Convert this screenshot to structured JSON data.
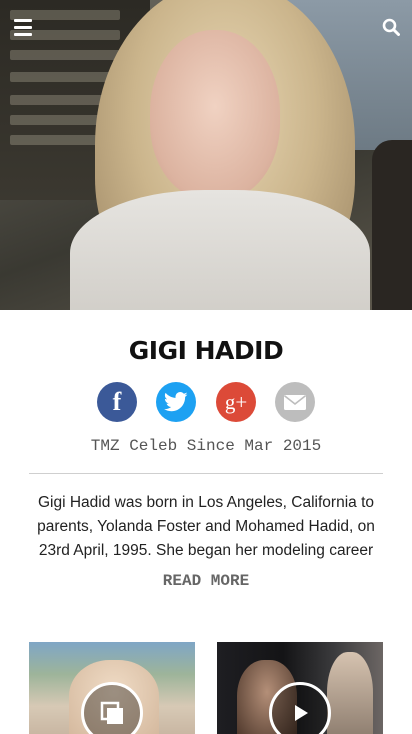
{
  "header": {
    "menu_icon": "hamburger-menu-icon",
    "search_icon": "search-icon"
  },
  "profile": {
    "name": "GIGI HADID",
    "since": "TMZ Celeb Since Mar 2015",
    "bio": "Gigi Hadid was born in Los Angeles, California to parents, Yolanda Foster and Mohamed Hadid, on 23rd April, 1995. She began her modeling career she was",
    "read_more": "READ MORE"
  },
  "social": {
    "facebook_glyph": "f",
    "google_plus_glyph": "g+",
    "icons": [
      "facebook-icon",
      "twitter-icon",
      "google-plus-icon",
      "email-icon"
    ],
    "colors": {
      "facebook": "#3b5998",
      "twitter": "#1da1f2",
      "google_plus": "#dc4a38",
      "email": "#bdbdbd"
    }
  },
  "thumbnails": [
    {
      "type": "gallery",
      "icon": "gallery-icon"
    },
    {
      "type": "video",
      "icon": "play-icon"
    }
  ]
}
